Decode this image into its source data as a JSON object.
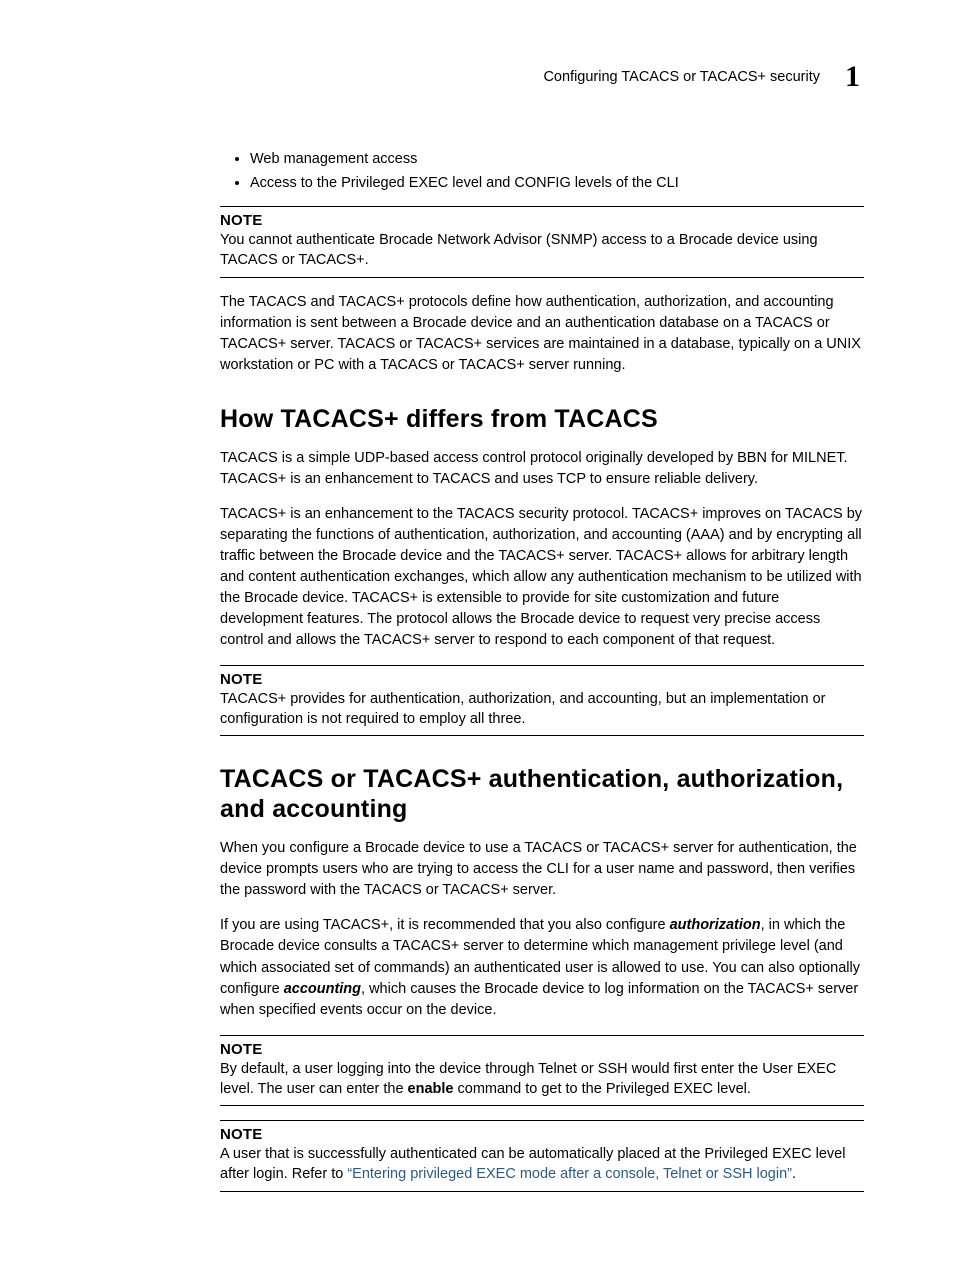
{
  "header": {
    "sectionTitle": "Configuring TACACS or TACACS+ security",
    "chapterNumber": "1"
  },
  "bullets": [
    "Web management access",
    "Access to the Privileged EXEC level and CONFIG levels of the CLI"
  ],
  "note1": {
    "label": "NOTE",
    "text": "You cannot authenticate Brocade Network Advisor (SNMP) access to a Brocade device using TACACS or TACACS+."
  },
  "para1": "The TACACS and TACACS+ protocols define how authentication, authorization, and accounting information is sent between a Brocade device and an authentication database on a TACACS or TACACS+ server. TACACS or TACACS+ services are maintained in a database, typically on a UNIX workstation or PC with a TACACS or TACACS+ server running.",
  "heading1": "How TACACS+ differs from TACACS",
  "para2": "TACACS is a simple UDP-based access control protocol originally developed by BBN for MILNET. TACACS+ is an enhancement to TACACS and uses TCP to ensure reliable delivery.",
  "para3": "TACACS+ is an enhancement to the TACACS security protocol. TACACS+ improves on TACACS by separating the functions of authentication, authorization, and accounting (AAA) and by encrypting all traffic between the Brocade device and the TACACS+ server. TACACS+ allows for arbitrary length and content authentication exchanges, which allow any authentication mechanism to be utilized with the Brocade device. TACACS+ is extensible to provide for site customization and future development features. The protocol allows the Brocade device to request very precise access control and allows the TACACS+ server to respond to each component of that request.",
  "note2": {
    "label": "NOTE",
    "text": "TACACS+ provides for authentication, authorization, and accounting, but an implementation or configuration is not required to employ all three."
  },
  "heading2": "TACACS or TACACS+ authentication, authorization, and accounting",
  "para4": "When you configure a Brocade device to use a TACACS or TACACS+ server for authentication, the device prompts users who are trying to access the CLI for a user name and password, then verifies the password with the TACACS or TACACS+ server.",
  "para5": {
    "s1": "If you are using TACACS+, it is recommended that you also configure ",
    "em1": "authorization",
    "s2": ", in which the Brocade device consults a TACACS+ server to determine which management privilege level (and which associated set of commands) an authenticated user is allowed to use. You can also optionally configure ",
    "em2": "accounting",
    "s3": ", which causes the Brocade device to log information on the TACACS+ server when specified events occur on the device."
  },
  "note3": {
    "label": "NOTE",
    "s1": "By default, a user logging into the device through Telnet or SSH would first enter the User EXEC level. The user can enter the ",
    "bold": "enable",
    "s2": " command to get to the Privileged EXEC level."
  },
  "note4": {
    "label": "NOTE",
    "s1": "A user that is successfully authenticated can be automatically placed at the Privileged EXEC level after login. Refer to ",
    "link": "“Entering privileged EXEC mode after a console, Telnet or SSH login”",
    "s2": "."
  }
}
